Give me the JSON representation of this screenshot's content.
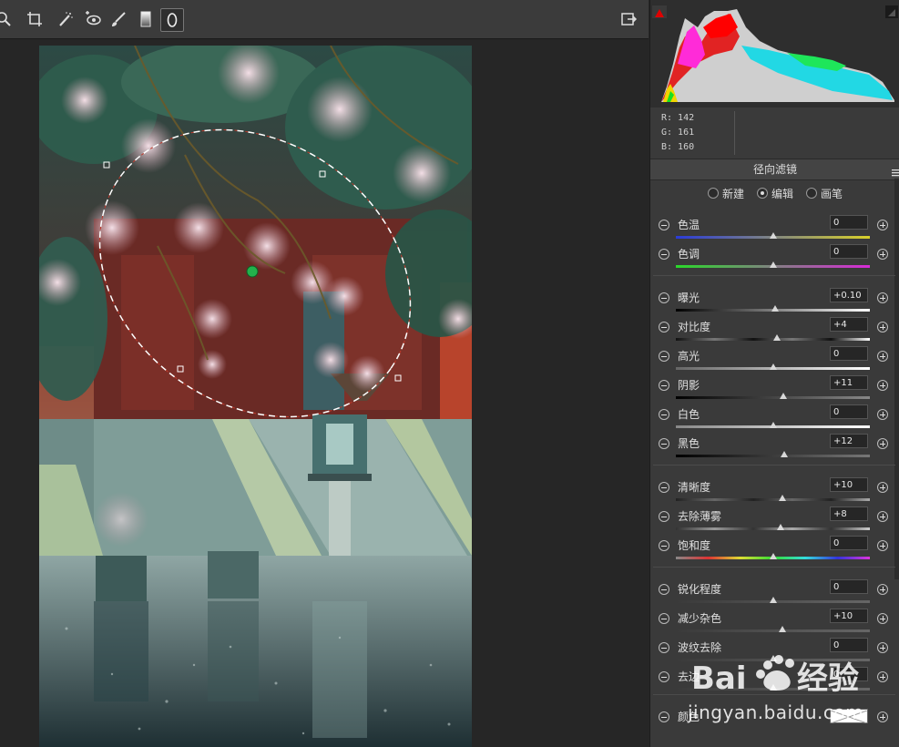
{
  "toolbar": {
    "tools": [
      "zoom-icon",
      "crop-icon",
      "spot-removal-icon",
      "red-eye-icon",
      "adjustment-brush-icon",
      "graduated-filter-icon",
      "radial-filter-icon"
    ],
    "export_icon": "export-icon"
  },
  "histogram": {
    "clip_warning_color": "#e00000",
    "readout": {
      "r": "R:    142",
      "g": "G:    161",
      "b": "B:    160"
    }
  },
  "panel": {
    "title": "径向滤镜",
    "modes": [
      {
        "label": "新建",
        "selected": false
      },
      {
        "label": "编辑",
        "selected": true
      },
      {
        "label": "画笔",
        "selected": false
      }
    ],
    "sliders": [
      {
        "label": "色温",
        "value": "0",
        "position": 0.5
      },
      {
        "label": "色调",
        "value": "0",
        "position": 0.5
      },
      {
        "label": "曝光",
        "value": "+0.10",
        "position": 0.51
      },
      {
        "label": "对比度",
        "value": "+4",
        "position": 0.52
      },
      {
        "label": "高光",
        "value": "0",
        "position": 0.5
      },
      {
        "label": "阴影",
        "value": "+11",
        "position": 0.555
      },
      {
        "label": "白色",
        "value": "0",
        "position": 0.5
      },
      {
        "label": "黑色",
        "value": "+12",
        "position": 0.56
      },
      {
        "label": "清晰度",
        "value": "+10",
        "position": 0.55
      },
      {
        "label": "去除薄雾",
        "value": "+8",
        "position": 0.54
      },
      {
        "label": "饱和度",
        "value": "0",
        "position": 0.5
      },
      {
        "label": "锐化程度",
        "value": "0",
        "position": 0.5
      },
      {
        "label": "减少杂色",
        "value": "+10",
        "position": 0.55
      },
      {
        "label": "波纹去除",
        "value": "0",
        "position": 0.5
      },
      {
        "label": "去边",
        "value": "0",
        "position": 0.5
      }
    ],
    "color_label": "颜色"
  },
  "watermark": {
    "text": "jingyan.baidu.com"
  }
}
